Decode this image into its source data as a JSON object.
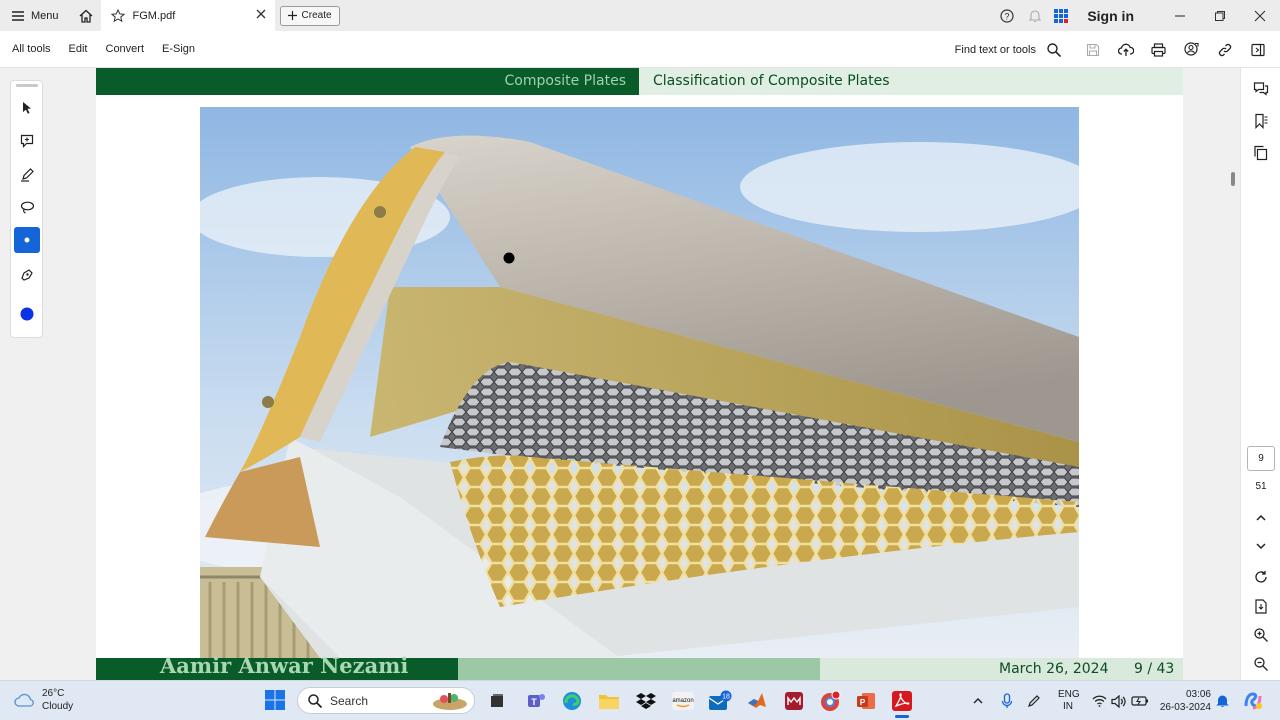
{
  "tabbar": {
    "menu_label": "Menu",
    "tab_title": "FGM.pdf",
    "create_label": "Create",
    "signin_label": "Sign in"
  },
  "toolbar": {
    "items": [
      "All tools",
      "Edit",
      "Convert",
      "E-Sign"
    ],
    "find_label": "Find text or tools"
  },
  "slide": {
    "header_section": "Composite Plates",
    "header_subsection": "Classification of Composite Plates",
    "footer_author": "Aamir Anwar Nezami",
    "footer_date": "March 26, 2024",
    "footer_page": "9 / 43"
  },
  "navigation": {
    "current_page": "9",
    "total_pages": "51"
  },
  "taskbar": {
    "weather_temp": "26°C",
    "weather_desc": "Cloudy",
    "search_label": "Search",
    "lang_top": "ENG",
    "lang_bottom": "IN",
    "time": "03:06",
    "date": "26-03-2024",
    "mail_badge": "18"
  },
  "colors": {
    "beamer_dark_green": "#0a5b2a",
    "beamer_light_green": "#e1eee3",
    "active_tool": "#1565d8",
    "acrobat_red": "#d5191f"
  }
}
